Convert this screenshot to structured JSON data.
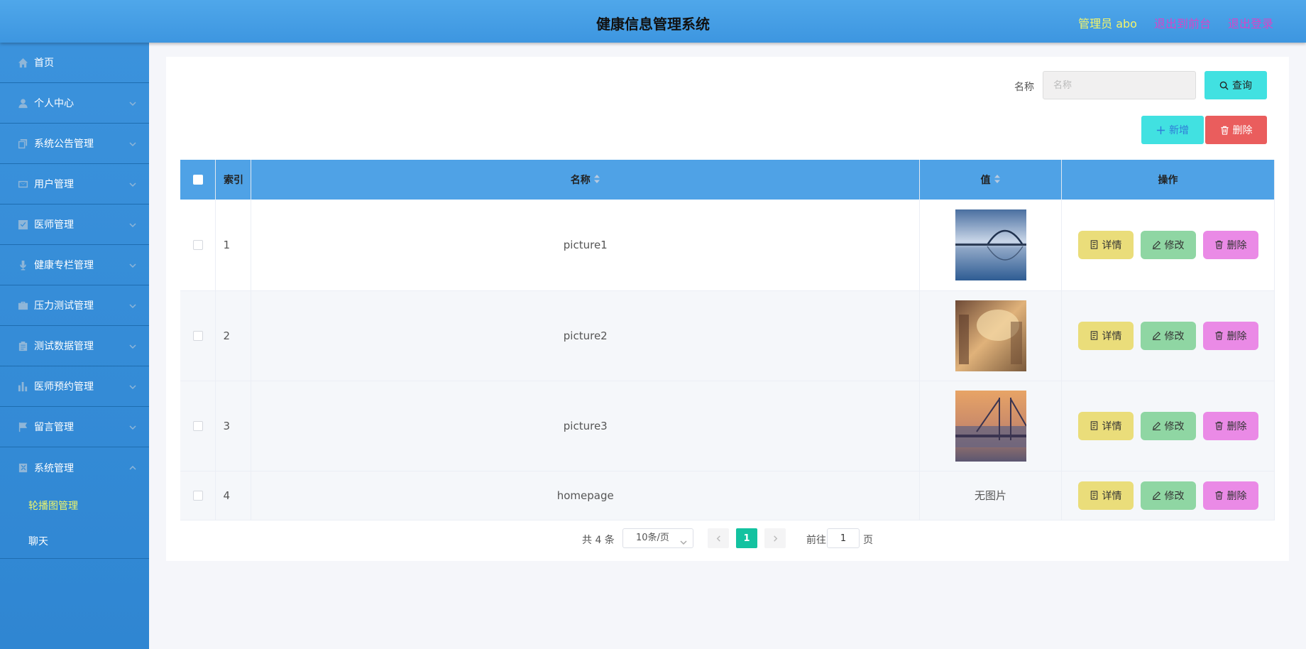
{
  "header": {
    "title": "健康信息管理系统",
    "admin": "管理员 abo",
    "exit_front": "退出到前台",
    "logout": "退出登录"
  },
  "sidebar": {
    "items": [
      {
        "label": "首页",
        "icon": "home-icon"
      },
      {
        "label": "个人中心",
        "icon": "user-icon"
      },
      {
        "label": "系统公告管理",
        "icon": "copy-icon"
      },
      {
        "label": "用户管理",
        "icon": "mail-icon"
      },
      {
        "label": "医师管理",
        "icon": "checkbox-icon"
      },
      {
        "label": "健康专栏管理",
        "icon": "microphone-icon"
      },
      {
        "label": "压力测试管理",
        "icon": "briefcase-icon"
      },
      {
        "label": "测试数据管理",
        "icon": "clipboard-icon"
      },
      {
        "label": "医师预约管理",
        "icon": "bar-chart-icon"
      },
      {
        "label": "留言管理",
        "icon": "flag-icon"
      },
      {
        "label": "系统管理",
        "icon": "trash-box-icon"
      }
    ],
    "sub_items": [
      {
        "label": "轮播图管理",
        "active": true
      },
      {
        "label": "聊天",
        "active": false
      }
    ]
  },
  "search": {
    "label": "名称",
    "placeholder": "名称",
    "value": "",
    "query_button": "查询"
  },
  "actions": {
    "add_button": "新增",
    "delete_button": "删除"
  },
  "table": {
    "columns": [
      "索引",
      "名称",
      "值",
      "操作"
    ],
    "rows": [
      {
        "index": "1",
        "name": "picture1",
        "value": "",
        "image": "bridge-sunset"
      },
      {
        "index": "2",
        "name": "picture2",
        "value": "",
        "image": "blurred-city"
      },
      {
        "index": "3",
        "name": "picture3",
        "value": "",
        "image": "city-bridge"
      },
      {
        "index": "4",
        "name": "homepage",
        "value": "无图片",
        "image": ""
      }
    ],
    "row_actions": {
      "detail": "详情",
      "edit": "修改",
      "delete": "删除"
    }
  },
  "pagination": {
    "total": "共 4 条",
    "page_size": "10条/页",
    "current_page": "1",
    "goto_label": "前往",
    "goto_value": "1",
    "page_suffix": "页"
  },
  "colors": {
    "header": "#4aa0e6",
    "sidebar": "#3589d6",
    "accent": "#41e1e1",
    "danger": "#ea5d5d",
    "page_active": "#13c2a0"
  }
}
